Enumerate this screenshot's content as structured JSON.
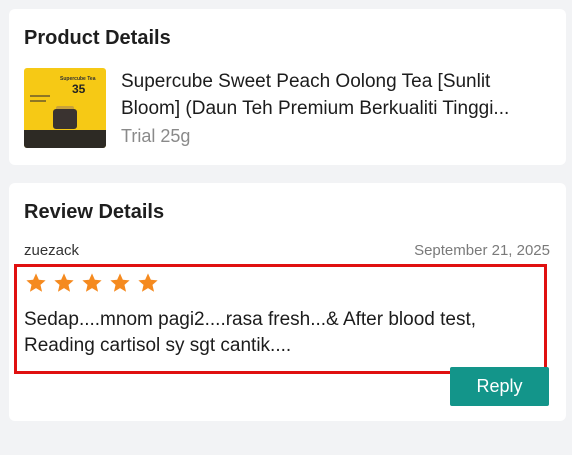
{
  "product_section": {
    "title": "Product Details",
    "product": {
      "name": "Supercube Sweet Peach Oolong Tea [Sunlit Bloom] (Daun Teh Premium Berkualiti Tinggi...",
      "variant": "Trial 25g",
      "thumbnail_price": "35",
      "thumbnail_tag": "Supercube Tea"
    }
  },
  "review_section": {
    "title": "Review Details",
    "reviewer": "zuezack",
    "date": "September 21, 2025",
    "rating": 5,
    "rating_max": 5,
    "star_color": "#f58a1f",
    "text": "Sedap....mnom pagi2....rasa fresh...& After blood test, Reading cartisol sy sgt cantik....",
    "highlight_color": "#e01010",
    "reply_label": "Reply",
    "reply_color": "#13958a"
  }
}
